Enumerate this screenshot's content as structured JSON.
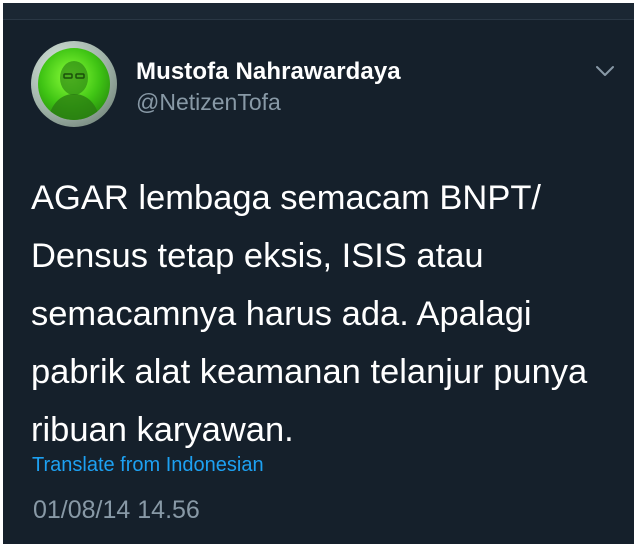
{
  "tweet": {
    "author": {
      "display_name": "Mustofa Nahrawardaya",
      "handle": "@NetizenTofa",
      "avatar_icon": "profile-avatar"
    },
    "menu_icon": "chevron-down-icon",
    "text_lines": [
      "AGAR lembaga semacam BNPT/",
      "Densus tetap eksis, ISIS atau",
      "semacamnya harus ada. Apalagi",
      "pabrik alat keamanan telanjur punya",
      "ribuan karyawan."
    ],
    "translate_label": "Translate from Indonesian",
    "timestamp": "01/08/14 14.56"
  },
  "colors": {
    "background": "#15202b",
    "primary_text": "#ffffff",
    "secondary_text": "#8899a6",
    "link": "#1da1f2",
    "avatar_accent": "#3fc414"
  }
}
